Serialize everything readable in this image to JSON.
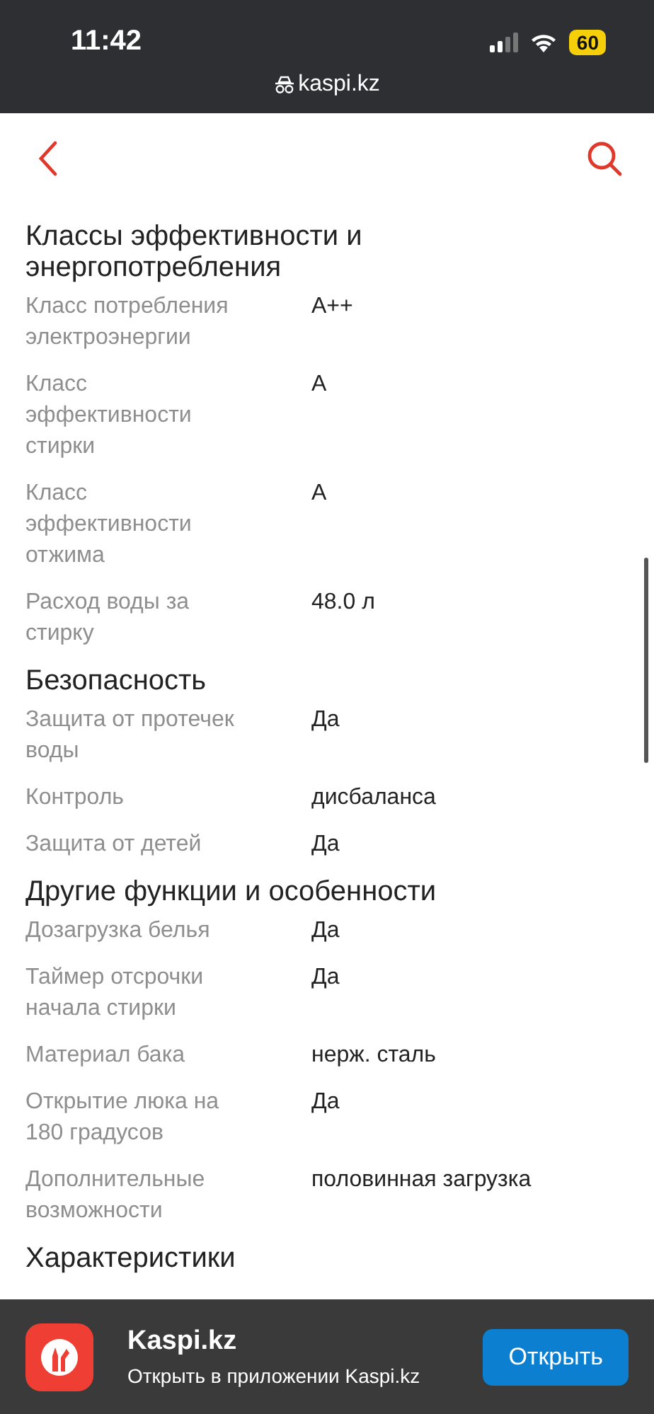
{
  "status_bar": {
    "time": "11:42",
    "battery": "60",
    "url": "kaspi.kz"
  },
  "sections": [
    {
      "title": "Классы эффективности и энергопотребления",
      "rows": [
        {
          "label": "Класс потребления электроэнергии",
          "value": "A++"
        },
        {
          "label": "Класс эффективности стирки",
          "value": "A"
        },
        {
          "label": "Класс эффективности отжима",
          "value": "A"
        },
        {
          "label": "Расход воды за стирку",
          "value": "48.0 л"
        }
      ]
    },
    {
      "title": "Безопасность",
      "rows": [
        {
          "label": "Защита от протечек воды",
          "value": "Да"
        },
        {
          "label": "Контроль",
          "value": "дисбаланса"
        },
        {
          "label": "Защита от детей",
          "value": "Да"
        }
      ]
    },
    {
      "title": "Другие функции и особенности",
      "rows": [
        {
          "label": "Дозагрузка белья",
          "value": "Да"
        },
        {
          "label": "Таймер отсрочки начала стирки",
          "value": "Да"
        },
        {
          "label": "Материал бака",
          "value": "нерж. сталь"
        },
        {
          "label": "Открытие люка на 180 градусов",
          "value": "Да"
        },
        {
          "label": "Дополнительные возможности",
          "value": "половинная загрузка"
        }
      ]
    },
    {
      "title": "Характеристики"
    }
  ],
  "banner": {
    "title": "Kaspi.kz",
    "subtitle": "Открыть в приложении Kaspi.kz",
    "button": "Открыть"
  }
}
